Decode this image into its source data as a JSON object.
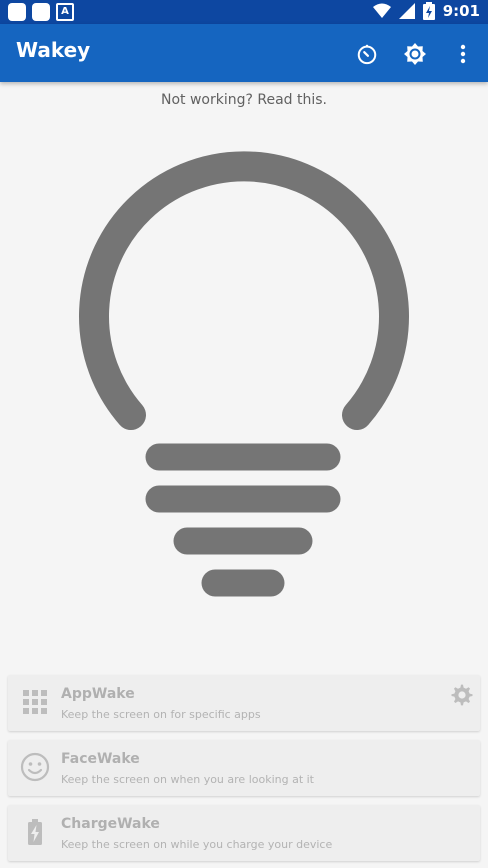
{
  "status_bar": {
    "time": "9:01",
    "left_icons": [
      "notification-square-icon",
      "notification-square-icon",
      "font-a-icon"
    ],
    "font_a_letter": "A",
    "right_icons": [
      "wifi-icon",
      "signal-icon",
      "battery-charging-icon"
    ]
  },
  "app_bar": {
    "title": "Wakey",
    "actions": [
      "timer-icon",
      "brightness-icon",
      "more-vert-icon"
    ],
    "color": "#1565c0"
  },
  "help_link": "Not working? Read this.",
  "bulb": {
    "color": "#757575"
  },
  "cards": [
    {
      "title": "AppWake",
      "subtitle": "Keep the screen on for specific apps",
      "icon": "apps-grid-icon",
      "has_settings": true
    },
    {
      "title": "FaceWake",
      "subtitle": "Keep the screen on when you are looking at it",
      "icon": "face-icon"
    },
    {
      "title": "ChargeWake",
      "subtitle": "Keep the screen on while you charge your device",
      "icon": "battery-charging-icon"
    }
  ]
}
